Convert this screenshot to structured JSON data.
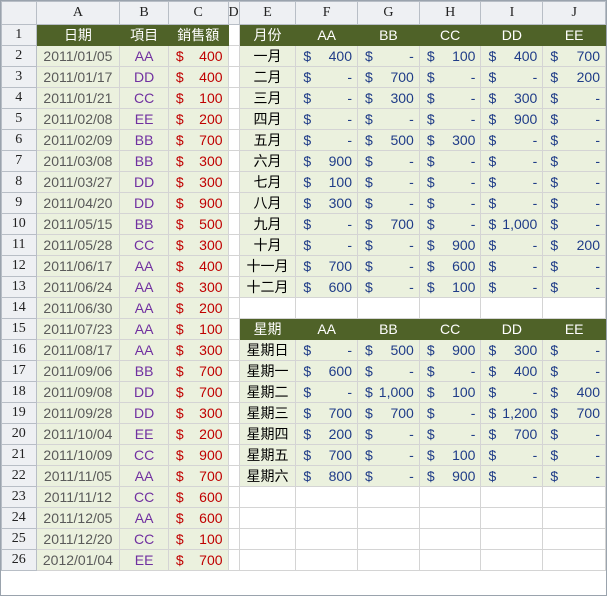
{
  "columns": [
    "A",
    "B",
    "C",
    "D",
    "E",
    "F",
    "G",
    "H",
    "I",
    "J"
  ],
  "row_numbers": [
    "1",
    "2",
    "3",
    "4",
    "5",
    "6",
    "7",
    "8",
    "9",
    "10",
    "11",
    "12",
    "13",
    "14",
    "15",
    "16",
    "17",
    "18",
    "19",
    "20",
    "21",
    "22",
    "23",
    "24",
    "25",
    "26"
  ],
  "sales": {
    "headers": [
      "日期",
      "項目",
      "銷售額"
    ],
    "rows": [
      {
        "date": "2011/01/05",
        "item": "AA",
        "amount": "400"
      },
      {
        "date": "2011/01/17",
        "item": "DD",
        "amount": "400"
      },
      {
        "date": "2011/01/21",
        "item": "CC",
        "amount": "100"
      },
      {
        "date": "2011/02/08",
        "item": "EE",
        "amount": "200"
      },
      {
        "date": "2011/02/09",
        "item": "BB",
        "amount": "700"
      },
      {
        "date": "2011/03/08",
        "item": "BB",
        "amount": "300"
      },
      {
        "date": "2011/03/27",
        "item": "DD",
        "amount": "300"
      },
      {
        "date": "2011/04/20",
        "item": "DD",
        "amount": "900"
      },
      {
        "date": "2011/05/15",
        "item": "BB",
        "amount": "500"
      },
      {
        "date": "2011/05/28",
        "item": "CC",
        "amount": "300"
      },
      {
        "date": "2011/06/17",
        "item": "AA",
        "amount": "400"
      },
      {
        "date": "2011/06/24",
        "item": "AA",
        "amount": "300"
      },
      {
        "date": "2011/06/30",
        "item": "AA",
        "amount": "200"
      },
      {
        "date": "2011/07/23",
        "item": "AA",
        "amount": "100"
      },
      {
        "date": "2011/08/17",
        "item": "AA",
        "amount": "300"
      },
      {
        "date": "2011/09/06",
        "item": "BB",
        "amount": "700"
      },
      {
        "date": "2011/09/08",
        "item": "DD",
        "amount": "700"
      },
      {
        "date": "2011/09/28",
        "item": "DD",
        "amount": "300"
      },
      {
        "date": "2011/10/04",
        "item": "EE",
        "amount": "200"
      },
      {
        "date": "2011/10/09",
        "item": "CC",
        "amount": "900"
      },
      {
        "date": "2011/11/05",
        "item": "AA",
        "amount": "700"
      },
      {
        "date": "2011/11/12",
        "item": "CC",
        "amount": "600"
      },
      {
        "date": "2011/12/05",
        "item": "AA",
        "amount": "600"
      },
      {
        "date": "2011/12/20",
        "item": "CC",
        "amount": "100"
      },
      {
        "date": "2012/01/04",
        "item": "EE",
        "amount": "700"
      }
    ]
  },
  "currency_symbol": "$",
  "monthly": {
    "corner_label": "月份",
    "item_headers": [
      "AA",
      "BB",
      "CC",
      "DD",
      "EE"
    ],
    "rows": [
      {
        "label": "一月",
        "values": [
          "400",
          "-",
          "100",
          "400",
          "700"
        ]
      },
      {
        "label": "二月",
        "values": [
          "-",
          "700",
          "-",
          "-",
          "200"
        ]
      },
      {
        "label": "三月",
        "values": [
          "-",
          "300",
          "-",
          "300",
          "-"
        ]
      },
      {
        "label": "四月",
        "values": [
          "-",
          "-",
          "-",
          "900",
          "-"
        ]
      },
      {
        "label": "五月",
        "values": [
          "-",
          "500",
          "300",
          "-",
          "-"
        ]
      },
      {
        "label": "六月",
        "values": [
          "900",
          "-",
          "-",
          "-",
          "-"
        ]
      },
      {
        "label": "七月",
        "values": [
          "100",
          "-",
          "-",
          "-",
          "-"
        ]
      },
      {
        "label": "八月",
        "values": [
          "300",
          "-",
          "-",
          "-",
          "-"
        ]
      },
      {
        "label": "九月",
        "values": [
          "-",
          "700",
          "-",
          "1,000",
          "-"
        ]
      },
      {
        "label": "十月",
        "values": [
          "-",
          "-",
          "900",
          "-",
          "200"
        ]
      },
      {
        "label": "十一月",
        "values": [
          "700",
          "-",
          "600",
          "-",
          "-"
        ]
      },
      {
        "label": "十二月",
        "values": [
          "600",
          "-",
          "100",
          "-",
          "-"
        ]
      }
    ]
  },
  "weekday": {
    "corner_label": "星期",
    "item_headers": [
      "AA",
      "BB",
      "CC",
      "DD",
      "EE"
    ],
    "rows": [
      {
        "label": "星期日",
        "values": [
          "-",
          "500",
          "900",
          "300",
          "-"
        ]
      },
      {
        "label": "星期一",
        "values": [
          "600",
          "-",
          "-",
          "400",
          "-"
        ]
      },
      {
        "label": "星期二",
        "values": [
          "-",
          "1,000",
          "100",
          "-",
          "400"
        ]
      },
      {
        "label": "星期三",
        "values": [
          "700",
          "700",
          "-",
          "1,200",
          "700"
        ]
      },
      {
        "label": "星期四",
        "values": [
          "200",
          "-",
          "-",
          "700",
          "-"
        ]
      },
      {
        "label": "星期五",
        "values": [
          "700",
          "-",
          "100",
          "-",
          "-"
        ]
      },
      {
        "label": "星期六",
        "values": [
          "800",
          "-",
          "900",
          "-",
          "-"
        ]
      }
    ]
  },
  "colors": {
    "header_green": "#4f6228",
    "light_green": "#ebf1de",
    "item_purple": "#7030a0",
    "amount_red": "#c00000",
    "value_blue": "#1f3c88"
  }
}
